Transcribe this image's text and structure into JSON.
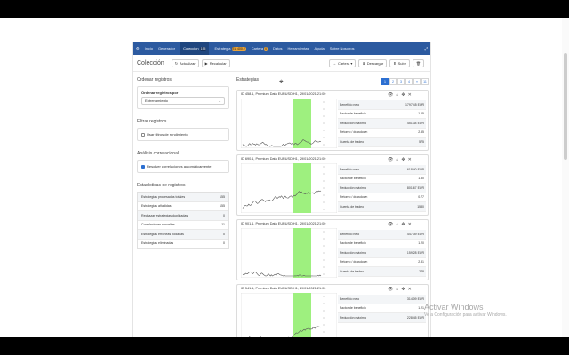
{
  "nav": {
    "items": [
      {
        "label": "Inicio",
        "badge": ""
      },
      {
        "label": "Generador",
        "badge": ""
      },
      {
        "label": "Colección",
        "badge": "155"
      },
      {
        "label": "Estrategia",
        "badge": "EA 400.2"
      },
      {
        "label": "Cartera",
        "badge": "0"
      },
      {
        "label": "Datos",
        "badge": ""
      },
      {
        "label": "Herramientas",
        "badge": ""
      },
      {
        "label": "Ayuda",
        "badge": ""
      },
      {
        "label": "Sobre Nosotros",
        "badge": ""
      }
    ]
  },
  "header": {
    "title": "Colección",
    "actualizar": "Actualizar",
    "recalcular": "Recalcular",
    "cartera": "Cartera ▾",
    "descargar": "Descargar",
    "subir": "Subir"
  },
  "left": {
    "ordenar_title": "Ordenar registros",
    "ordenar_label": "Ordenar registros por",
    "ordenar_value": "Entrenamiento",
    "filtrar_title": "Filtrar registros",
    "filtrar_check": "Usar filtros de rendimiento",
    "analisis_title": "Análisis correlacional",
    "analisis_check": "Resolver correlaciones automáticamente",
    "stats_title": "Estadísticas de registros",
    "stats": [
      {
        "label": "Estrategias procesadas totales",
        "value": "155"
      },
      {
        "label": "Estrategias añadidas",
        "value": "155"
      },
      {
        "label": "Rechazar estrategias duplicadas",
        "value": "0"
      },
      {
        "label": "Correlaciones resueltas",
        "value": "11"
      },
      {
        "label": "Estrategias erroneas podadas",
        "value": "0"
      },
      {
        "label": "Estrategias eliminadas",
        "value": "0"
      }
    ]
  },
  "right": {
    "title": "Estrategias",
    "pages": [
      "1",
      "2",
      "3",
      "4",
      "»",
      "11"
    ],
    "metric_labels": [
      "Beneficio neto",
      "Factor de beneficio",
      "Reducción máxima",
      "Retorno / drawdown",
      "Cuenta de tradeo"
    ],
    "cards": [
      {
        "title": "ID 458.1, Premium Data EURUSD H1, 29/01/2021 21:00",
        "values": [
          "1797.45 EUR",
          "1.65",
          "451.34 EUR",
          "2.55",
          "575"
        ]
      },
      {
        "title": "ID 690.1, Premium Data EURUSD H1, 29/01/2021 21:00",
        "values": [
          "618.40 EUR",
          "1.80",
          "801.67 EUR",
          "0.77",
          "1580"
        ]
      },
      {
        "title": "ID 901.1, Premium Data EURUSD H1, 29/01/2021 21:00",
        "values": [
          "447.39 EUR",
          "1.20",
          "159.28 EUR",
          "2.81",
          "278"
        ]
      },
      {
        "title": "ID 541.1, Premium Data EURUSD H1, 29/01/2021 21:00",
        "values": [
          "314.09 EUR",
          "1.21",
          "228.45 EUR",
          "",
          ""
        ]
      }
    ]
  },
  "watermark": {
    "title": "Activar Windows",
    "sub": "Ve a Configuración para activar Windows."
  },
  "colors": {
    "nav_bg": "#2c5aa0",
    "accent": "#2c6fd1",
    "oos_band": "#9ef07f",
    "balance_line": "#555555"
  }
}
